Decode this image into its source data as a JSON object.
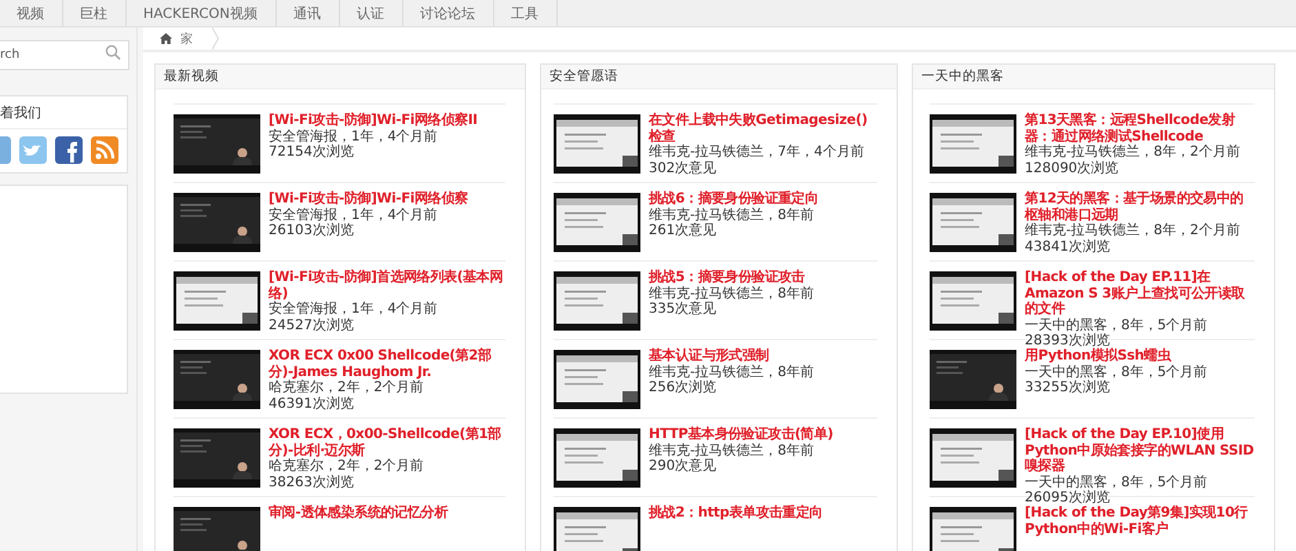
{
  "nav": {
    "items": [
      {
        "label": "视频"
      },
      {
        "label": "巨柱"
      },
      {
        "label": "HACKERCON视频"
      },
      {
        "label": "通讯"
      },
      {
        "label": "认证"
      },
      {
        "label": "讨论论坛"
      },
      {
        "label": "工具"
      }
    ]
  },
  "sidebar": {
    "search": {
      "placeholder": "rch"
    },
    "follow_title": "着我们"
  },
  "breadcrumb": {
    "home": "家"
  },
  "panels": [
    {
      "title": "最新视频",
      "items": [
        {
          "title": "[Wi-Fi攻击-防御]Wi-Fi网络侦察II",
          "meta": "安全管海报，1年，4个月前",
          "views": "72154次浏览"
        },
        {
          "title": "[Wi-Fi攻击-防御]Wi-Fi网络侦察",
          "meta": "安全管海报，1年，4个月前",
          "views": "26103次浏览"
        },
        {
          "title": "[Wi-Fi攻击-防御]首选网络列表(基本网络)",
          "meta": "安全管海报，1年，4个月前",
          "views": "24527次浏览"
        },
        {
          "title": "XOR ECX 0x00 Shellcode(第2部分)-James Haughom Jr.",
          "meta": "哈克塞尔，2年，2个月前",
          "views": "46391次浏览"
        },
        {
          "title": "XOR ECX，0x00-Shellcode(第1部分)-比利·迈尔斯",
          "meta": "哈克塞尔，2年，2个月前",
          "views": "38263次浏览"
        },
        {
          "title": "审阅-透体感染系统的记忆分析"
        }
      ]
    },
    {
      "title": "安全管愿语",
      "items": [
        {
          "title": "在文件上载中失败Getimagesize()检查",
          "meta": "维韦克-拉马铁德兰，7年，4个月前",
          "views": "302次意见"
        },
        {
          "title": "挑战6：摘要身份验证重定向",
          "meta": "维韦克-拉马铁德兰，8年前",
          "views": "261次意见"
        },
        {
          "title": "挑战5：摘要身份验证攻击",
          "meta": "维韦克-拉马铁德兰，8年前",
          "views": "335次意见"
        },
        {
          "title": "基本认证与形式强制",
          "meta": "维韦克-拉马铁德兰，8年前",
          "views": "256次浏览"
        },
        {
          "title": "HTTP基本身份验证攻击(简单)",
          "meta": "维韦克-拉马铁德兰，8年前",
          "views": "290次意见"
        },
        {
          "title": "挑战2：http表单攻击重定向"
        }
      ]
    },
    {
      "title": "一天中的黑客",
      "items": [
        {
          "title": "第13天黑客：远程Shellcode发射器：通过网络测试Shellcode",
          "meta": "维韦克-拉马铁德兰，8年，2个月前",
          "views": "128090次浏览"
        },
        {
          "title": "第12天的黑客：基于场景的交易中的枢轴和港口远期",
          "meta": "维韦克-拉马铁德兰，8年，2个月前",
          "views": "43841次浏览"
        },
        {
          "title": "[Hack of the Day EP.11]在Amazon S 3账户上查找可公开读取的文件",
          "meta": "一天中的黑客，8年，5个月前",
          "views": "28393次浏览"
        },
        {
          "title": "用Python模拟Ssh蠕虫",
          "meta": "一天中的黑客，8年，5个月前",
          "views": "33255次浏览"
        },
        {
          "title": "[Hack of the Day EP.10]使用Python中原始套接字的WLAN SSID嗅探器",
          "meta": "一天中的黑客，8年，5个月前",
          "views": "26095次浏览"
        },
        {
          "title": "[Hack of the Day第9集]实现10行Python中的Wi-Fi客户"
        }
      ]
    }
  ]
}
